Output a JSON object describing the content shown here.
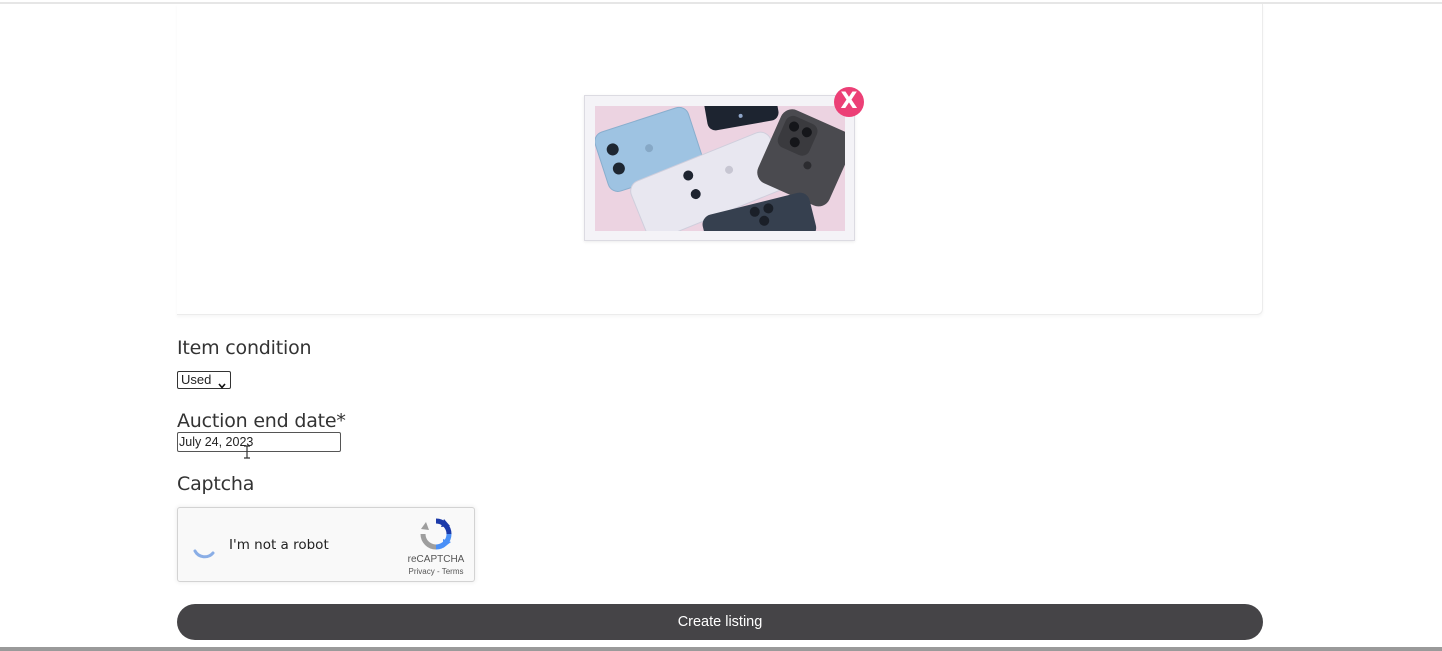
{
  "image_upload": {
    "remove_label": "X",
    "remove_color": "#ec3f76"
  },
  "condition": {
    "label": "Item condition",
    "selected": "Used"
  },
  "auction_end": {
    "label": "Auction end date*",
    "value": "July 24, 2023"
  },
  "captcha": {
    "label": "Captcha",
    "checkbox_text": "I'm not a robot",
    "brand": "reCAPTCHA",
    "privacy": "Privacy",
    "separator": "-",
    "terms": "Terms"
  },
  "submit": {
    "label": "Create listing",
    "color": "#454447"
  }
}
